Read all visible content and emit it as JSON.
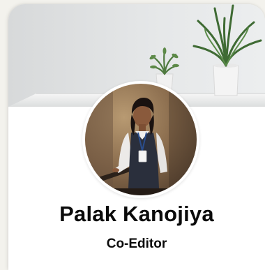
{
  "profile": {
    "name": "Palak Kanojiya",
    "role": "Co-Editor",
    "avatar_icon": "profile-photo",
    "cover_icon": "cover-photo-plants"
  },
  "colors": {
    "card_background": "#ffffff",
    "text": "#0b0b0b",
    "page_background": "#f3f2ed"
  }
}
